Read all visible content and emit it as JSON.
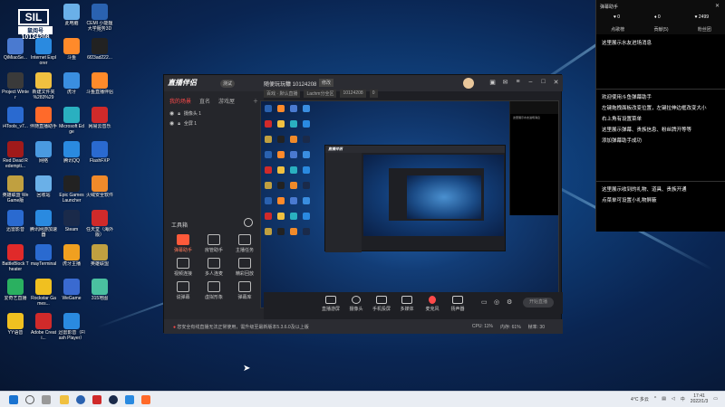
{
  "desktop": {
    "logo": {
      "box": "SIL",
      "name": "鼠阅号",
      "number": "10124208"
    },
    "icons": [
      {
        "label": "此电脑",
        "color": "#6ab0e8"
      },
      {
        "label": "CEMI 小能狸大学服务3D世界3",
        "color": "#2a62b0"
      },
      {
        "label": "QiMiaoSe...",
        "color": "#4a7ad0"
      },
      {
        "label": "Internet Explorer",
        "color": "#2a8ae0"
      },
      {
        "label": "斗鱼",
        "color": "#ff8a2a"
      },
      {
        "label": "6f23ad222...",
        "color": "#222"
      },
      {
        "label": "Project Winter",
        "color": "#3a3a3a"
      },
      {
        "label": "新建文件夹 %283%29",
        "color": "#f0c040"
      },
      {
        "label": "虎牙",
        "color": "#3a8ee0"
      },
      {
        "label": "斗鱼直播伴侣",
        "color": "#ff8a2a"
      },
      {
        "label": "i4Tools_v7...",
        "color": "#2a6ad0"
      },
      {
        "label": "伴随直播助手",
        "color": "#ff6a2a"
      },
      {
        "label": "Microsoft Edge",
        "color": "#2ab0c0"
      },
      {
        "label": "网易云音乐",
        "color": "#d02a2a"
      },
      {
        "label": "Red Dead Redempti...",
        "color": "#a01a1a"
      },
      {
        "label": "网络",
        "color": "#4a9ae0"
      },
      {
        "label": "腾讯QQ",
        "color": "#2a8ae0"
      },
      {
        "label": "FlashFXP",
        "color": "#2a6ad0"
      },
      {
        "label": "英雄联盟 WeGame版",
        "color": "#c0a040"
      },
      {
        "label": "回收站",
        "color": "#6ab0e8"
      },
      {
        "label": "Epic Games Launcher",
        "color": "#222"
      },
      {
        "label": "火绒安全软件",
        "color": "#f08a2a"
      },
      {
        "label": "迅雷影音",
        "color": "#2a6ad0"
      },
      {
        "label": "腾讯网游加速器",
        "color": "#2a8ae0"
      },
      {
        "label": "Steam",
        "color": "#1a2a4a"
      },
      {
        "label": "任天堂（海外版）",
        "color": "#d02a2a"
      },
      {
        "label": "BattleBlock Theater",
        "color": "#e02a2a"
      },
      {
        "label": "mayTerminal",
        "color": "#2a6ad0"
      },
      {
        "label": "虎牙主播",
        "color": "#f0a020"
      },
      {
        "label": "英雄联盟",
        "color": "#c0a040"
      },
      {
        "label": "爱奇艺直播",
        "color": "#2ab060"
      },
      {
        "label": "Rockstar Games...",
        "color": "#f0c020"
      },
      {
        "label": "WeGame",
        "color": "#3a6ad0"
      },
      {
        "label": "315地图",
        "color": "#4ac0a0"
      },
      {
        "label": "YY语音",
        "color": "#f0c020"
      },
      {
        "label": "Adobe Creati...",
        "color": "#d02a2a"
      },
      {
        "label": "迅雷影音（Flash Player）",
        "color": "#2a8ae0"
      }
    ]
  },
  "app": {
    "logo": "直播伴侣",
    "badge": "测试",
    "left_tabs": [
      "我的场景",
      "直名",
      "游戏屋"
    ],
    "scenes": [
      "摄像头 1",
      "全屏 1"
    ],
    "tools_title": "工具箱",
    "tools": [
      {
        "label": "弹幕助手",
        "hot": true
      },
      {
        "label": "房管助手",
        "hot": false
      },
      {
        "label": "主播任务",
        "hot": false
      },
      {
        "label": "视频连接",
        "hot": false
      },
      {
        "label": "多人连麦",
        "hot": false
      },
      {
        "label": "精彩回放",
        "hot": false
      },
      {
        "label": "说弹幕",
        "hot": false
      },
      {
        "label": "虚拟形象",
        "hot": false
      },
      {
        "label": "弹幕库",
        "hot": false
      }
    ],
    "room_name": "随便玩玩糠 10124208",
    "room_edit": "修改",
    "room_sub": [
      "百戏 · 默认直播",
      "Lachm分全区",
      "10124208",
      "0"
    ],
    "bottom_items": [
      "直播游屏",
      "摄像头",
      "手机投屏",
      "多媒体",
      "麦克风",
      "扬声器"
    ],
    "live_button": "开始直播",
    "status_warning": "您安全有线直播无法正常使用，需升级至最新版本5.3.6.0及以上版",
    "stats": [
      "CPU: 11%",
      "内存: 61%",
      "帧率: 30"
    ]
  },
  "assistant": {
    "title": "弹幕助手",
    "stats": [
      "0",
      "0",
      "2499"
    ],
    "tabs": [
      "点歌榜",
      "贡献(5)",
      "粉丝团"
    ],
    "msg1": "这里展示水友进场消息",
    "msg2": [
      "欢迎使用斗鱼弹幕助手",
      "左键拖拽面板改变位置，左键拉伸边框改变大小",
      "右上角有设置菜单",
      "这里展示弹幕、贵族信息、粉丝牌开等等",
      "添加弹幕助手成功"
    ],
    "msg3": [
      "这里展示收到的礼物、道具、贵族开通",
      "点菜单可设置小礼物屏蔽"
    ]
  },
  "taskbar": {
    "weather": "4°C 多云",
    "time": "17:41",
    "date": "2022/1/3",
    "lang": "中"
  }
}
